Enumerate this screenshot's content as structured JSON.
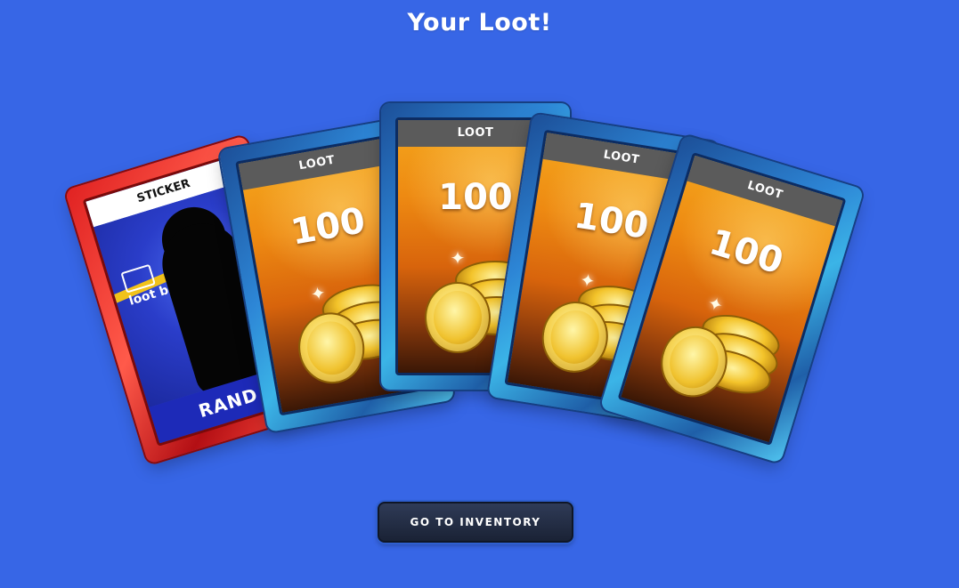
{
  "header": {
    "title": "Your Loot!"
  },
  "cards": [
    {
      "kind": "sticker",
      "header": "STICKER",
      "logo": "loot boy",
      "footer": "RAND"
    },
    {
      "kind": "coins",
      "header": "LOOT",
      "amount": "100"
    },
    {
      "kind": "coins",
      "header": "LOOT",
      "amount": "100"
    },
    {
      "kind": "coins",
      "header": "LOOT",
      "amount": "100"
    },
    {
      "kind": "coins",
      "header": "LOOT",
      "amount": "100"
    }
  ],
  "actions": {
    "inventory_label": "GO TO INVENTORY"
  },
  "colors": {
    "background": "#3766e6",
    "loot_frame": "#2d86d6",
    "sticker_frame": "#e02222",
    "button": "#1a2235"
  },
  "icons": {
    "card_art": "gold-coins-icon",
    "sparkle": "sparkle-icon"
  }
}
